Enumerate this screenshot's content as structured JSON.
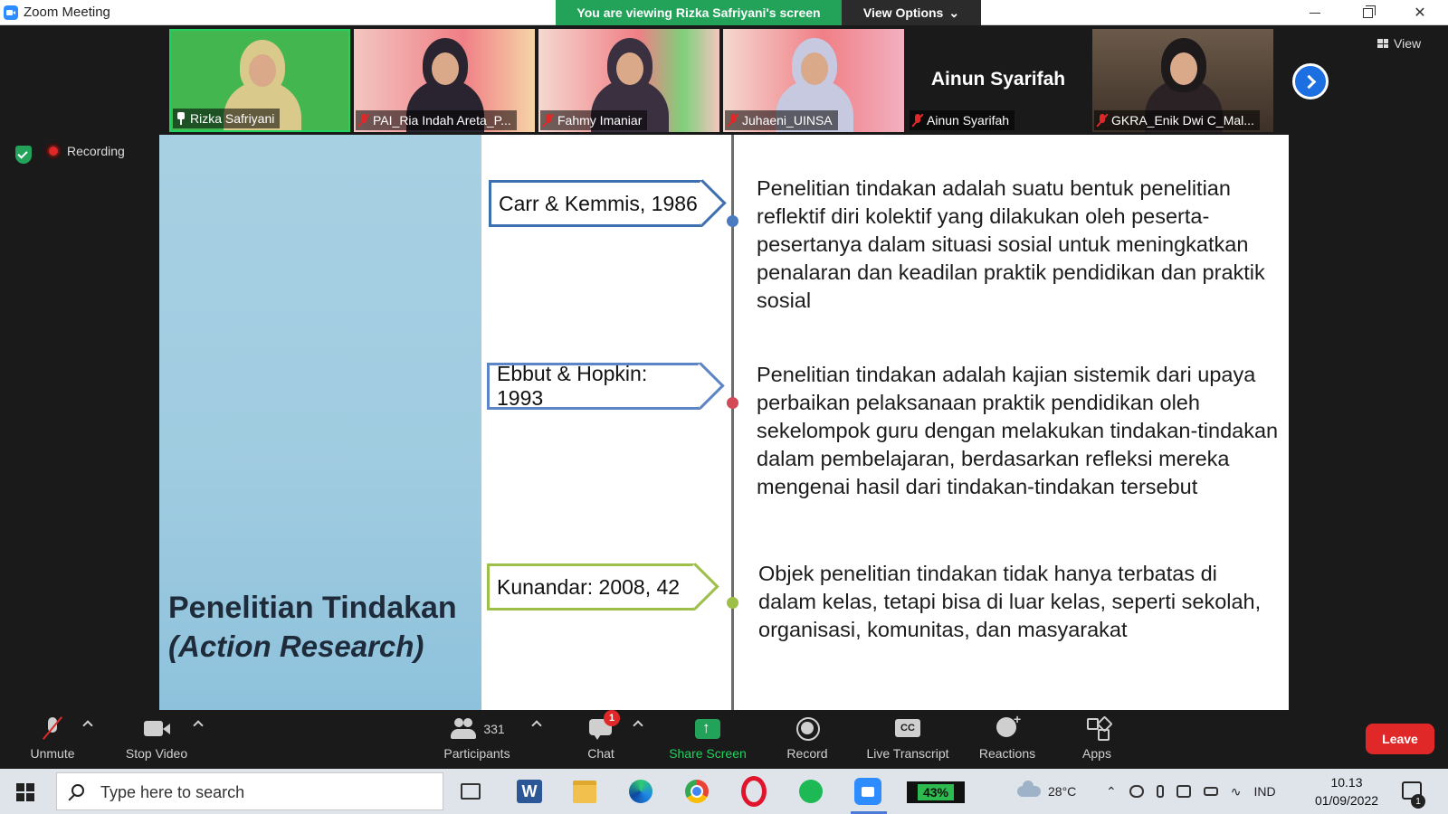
{
  "window": {
    "title": "Zoom Meeting",
    "viewing_banner": "You are viewing Rizka Safriyani's screen",
    "view_options": "View Options"
  },
  "participants_strip": [
    {
      "name": "Rizka Safriyani",
      "pinned": true,
      "muted": false,
      "active_speaker": true
    },
    {
      "name": "PAI_Ria Indah Areta_P...",
      "muted": true
    },
    {
      "name": "Fahmy Imaniar",
      "muted": true
    },
    {
      "name": "Juhaeni_UINSA",
      "muted": true
    },
    {
      "name": "Ainun Syarifah",
      "muted": true,
      "video_off": true,
      "display_name": "Ainun Syarifah"
    },
    {
      "name": "GKRA_Enik Dwi C_Mal...",
      "muted": true
    }
  ],
  "view_button": "View",
  "recording_label": "Recording",
  "slide": {
    "title_line1": "Penelitian Tindakan",
    "title_line2": "(Action Research)",
    "entries": [
      {
        "reference": "Carr & Kemmis, 1986",
        "text": "Penelitian tindakan adalah suatu bentuk penelitian reflektif diri kolektif yang dilakukan oleh peserta-pesertanya dalam situasi sosial untuk meningkatkan penalaran dan keadilan praktik pendidikan dan praktik sosial",
        "color": "#3e6fb0"
      },
      {
        "reference": "Ebbut & Hopkin: 1993",
        "text": "Penelitian tindakan adalah kajian sistemik dari upaya perbaikan pelaksanaan praktik pendidikan oleh sekelompok guru dengan melakukan tindakan-tindakan dalam pembelajaran, berdasarkan refleksi mereka mengenai hasil dari tindakan-tindakan tersebut",
        "color": "#d24a57"
      },
      {
        "reference": "Kunandar: 2008, 42",
        "text": "Objek penelitian tindakan tidak hanya terbatas di dalam kelas, tetapi bisa di luar kelas, seperti sekolah, organisasi, komunitas, dan masyarakat",
        "color": "#9cbf47"
      }
    ]
  },
  "toolbar": {
    "unmute": "Unmute",
    "stop_video": "Stop Video",
    "participants_count": "331",
    "participants": "Participants",
    "chat_badge": "1",
    "chat": "Chat",
    "share_screen": "Share Screen",
    "record": "Record",
    "live_transcript": "Live Transcript",
    "reactions": "Reactions",
    "apps": "Apps",
    "leave": "Leave"
  },
  "taskbar": {
    "search_placeholder": "Type here to search",
    "battery": "43%",
    "temperature": "28°C",
    "language": "IND",
    "time": "10.13",
    "date": "01/09/2022",
    "notification_count": "1"
  }
}
